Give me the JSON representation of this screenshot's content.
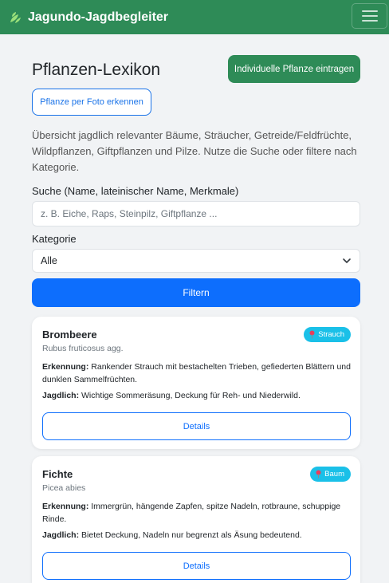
{
  "navbar": {
    "brand": "Jagundo-Jagdbegleiter",
    "brand_icon": "leaf-icon",
    "menu_icon": "hamburger-menu-icon",
    "bg_color": "#2e8b57"
  },
  "page": {
    "title": "Pflanzen-Lexikon",
    "add_button": "Individuelle Pflanze eintragen",
    "photo_button": "Pflanze per Foto erkennen",
    "intro": "Übersicht jagdlich relevanter Bäume, Sträucher, Getreide/Feldfrüchte, Wildpflanzen, Giftpflanzen und Pilze. Nutze die Suche oder filtere nach Kategorie."
  },
  "search": {
    "label": "Suche (Name, lateinischer Name, Merkmale)",
    "placeholder": "z. B. Eiche, Raps, Steinpilz, Giftpflanze ...",
    "value": ""
  },
  "category": {
    "label": "Kategorie",
    "selected": "Alle",
    "chevron_icon": "chevron-down-icon"
  },
  "filter_button": "Filtern",
  "plants": [
    {
      "name": "Brombeere",
      "latin": "Rubus fruticosus agg.",
      "badge": "Strauch",
      "badge_icon": "pin-icon",
      "recognition_label": "Erkennung:",
      "recognition": "Rankender Strauch mit bestachelten Trieben, gefiederten Blättern und dunklen Sammelfrüchten.",
      "hunting_label": "Jagdlich:",
      "hunting": "Wichtige Sommeräsung, Deckung für Reh- und Niederwild.",
      "details": "Details"
    },
    {
      "name": "Fichte",
      "latin": "Picea abies",
      "badge": "Baum",
      "badge_icon": "pin-icon",
      "recognition_label": "Erkennung:",
      "recognition": "Immergrün, hängende Zapfen, spitze Nadeln, rotbraune, schuppige Rinde.",
      "hunting_label": "Jagdlich:",
      "hunting": "Bietet Deckung, Nadeln nur begrenzt als Äsung bedeutend.",
      "details": "Details"
    }
  ],
  "colors": {
    "primary": "#0d6efd",
    "brand_green": "#2e8b57",
    "badge_cyan": "#1ac0e8"
  }
}
